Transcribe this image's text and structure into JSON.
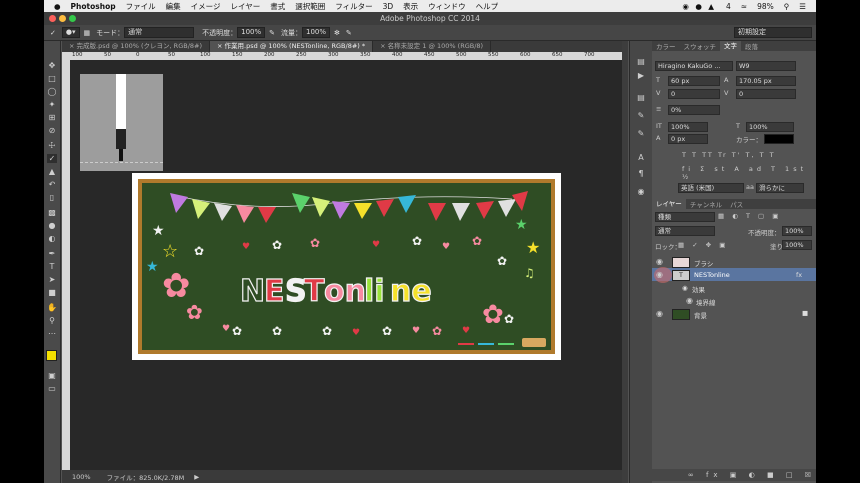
{
  "menubar": {
    "items": [
      "Photoshop",
      "ファイル",
      "編集",
      "イメージ",
      "レイヤー",
      "書式",
      "選択範囲",
      "フィルター",
      "3D",
      "表示",
      "ウィンドウ",
      "ヘルプ"
    ],
    "battery": "98%",
    "time": "4"
  },
  "window": {
    "title": "Adobe Photoshop CC 2014"
  },
  "options": {
    "mode_label": "モード：",
    "mode_value": "通常",
    "opacity_label": "不透明度：",
    "opacity_value": "100%",
    "flow_label": "流量：",
    "flow_value": "100%",
    "workspace": "初期設定"
  },
  "tabs": [
    {
      "label": "完成版.psd @ 100% (クレヨン, RGB/8#)"
    },
    {
      "label": "作業用.psd @ 100% (NESTonline, RGB/8#) *"
    },
    {
      "label": "名称未設定 1 @ 100% (RGB/8)"
    }
  ],
  "ruler": {
    "ticks": [
      "100",
      "50",
      "0",
      "50",
      "100",
      "150",
      "200",
      "250",
      "300",
      "350",
      "400",
      "450",
      "500",
      "550",
      "600",
      "650",
      "700"
    ]
  },
  "artwork": {
    "title_parts": [
      "N",
      "E",
      "S",
      "T",
      "on",
      "li",
      "ne"
    ],
    "colors": {
      "board": "#2f4d24",
      "frame": "#b07a2c",
      "chalk_white": "#f2f2f2",
      "red": "#e03a46",
      "yellow": "#f5e12a",
      "pink": "#f78aa0",
      "green": "#9be33a"
    }
  },
  "status": {
    "zoom": "100%",
    "file_label": "ファイル：825.0K/2.78M"
  },
  "panels": {
    "top_tabs": [
      "カラー",
      "スウォッチ",
      "文字",
      "段落"
    ],
    "active_top_tab": "文字",
    "font_family": "Hiragino KakuGo ...",
    "font_style": "W9",
    "font_size": "60 px",
    "leading": "170.05 px",
    "kerning": "0",
    "tracking": "0",
    "tsume": "0%",
    "vscale": "100%",
    "hscale": "100%",
    "baseline": "0 px",
    "color_label": "カラー：",
    "language": "英語 (米国)",
    "antialias": "滑らかに",
    "layer_tabs": [
      "レイヤー",
      "チャンネル",
      "パス"
    ],
    "filter_kind": "種類",
    "blend_mode": "通常",
    "opacity_label": "不透明度：",
    "opacity_value": "100%",
    "lock_label": "ロック：",
    "fill_label": "塗り：",
    "fill_value": "100%",
    "layers": [
      {
        "name": "ブラシ"
      },
      {
        "name": "NESTonline",
        "fx": "fx"
      },
      {
        "name": "効果"
      },
      {
        "name": "境界線"
      },
      {
        "name": "背景"
      }
    ]
  }
}
